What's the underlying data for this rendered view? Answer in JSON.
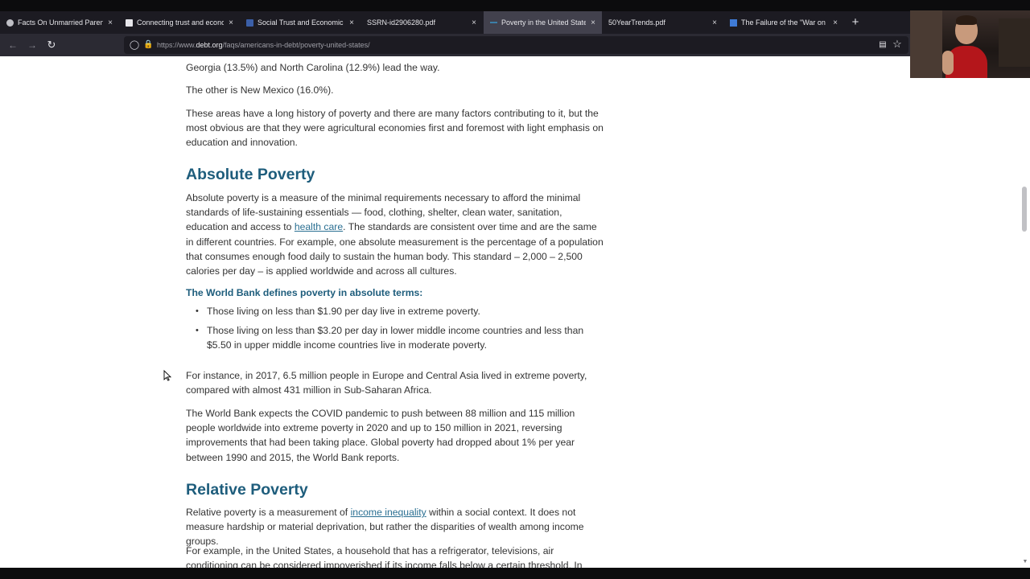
{
  "browser": {
    "tabs": [
      {
        "title": "Facts On Unmarried Parents in the",
        "favicon_color": "#bfbfc5"
      },
      {
        "title": "Connecting trust and economic",
        "favicon_color": "#e6e6ea"
      },
      {
        "title": "Social Trust and Economic Growth",
        "favicon_color": "#3b5fa8"
      },
      {
        "title": "SSRN-id2906280.pdf",
        "favicon_color": "#1c1b22"
      },
      {
        "title": "Poverty in the United States",
        "favicon_color": "#3c7fa8",
        "active": true
      },
      {
        "title": "50YearTrends.pdf",
        "favicon_color": "#1c1b22"
      },
      {
        "title": "The Failure of the \"War on Poverty\"",
        "favicon_color": "#3f7bd6"
      }
    ],
    "close_glyph": "×",
    "new_tab_glyph": "+",
    "url_prefix": "https://www.",
    "url_domain": "debt.org",
    "url_path": "/faqs/americans-in-debt/poverty-united-states/",
    "icons": {
      "back": "back-arrow-icon",
      "forward": "forward-arrow-icon",
      "reload": "reload-icon",
      "shield": "tracking-shield-icon",
      "lock": "lock-icon",
      "reader": "reader-view-icon",
      "bookmark": "bookmark-star-icon"
    }
  },
  "article": {
    "intro_line": "Georgia (13.5%) and North Carolina (12.9%) lead the way.",
    "other_line": "The other is New Mexico (16.0%).",
    "areas_paragraph": "These areas have a long history of poverty and there are many factors contributing to it, but the most obvious are that they were agricultural economies first and foremost with light emphasis on education and innovation.",
    "absolute_heading": "Absolute Poverty",
    "absolute_p_before_link": "Absolute poverty is a measure of the minimal requirements necessary to afford the minimal standards of life-sustaining essentials — food, clothing, shelter, clean water, sanitation, education and access to ",
    "absolute_link": "health care",
    "absolute_p_after_link": ". The standards are consistent over time and are the same in different countries. For example, one absolute measurement is the percentage of a population that consumes enough food daily to sustain the human body. This standard – 2,000 – 2,500 calories per day – is applied worldwide and across all cultures.",
    "world_bank_subheading": "The World Bank defines poverty in absolute terms:",
    "bullets": [
      "Those living on less than $1.90 per day live in extreme poverty.",
      "Those living on less than $3.20 per day in lower middle income countries and less than $5.50 in upper middle income countries live in moderate poverty."
    ],
    "instance_paragraph": "For instance, in 2017, 6.5 million people in Europe and Central Asia lived in extreme poverty, compared with almost 431 million in Sub-Saharan Africa.",
    "covid_paragraph": "The World Bank expects the COVID pandemic to push between 88 million and 115 million people worldwide into extreme poverty in 2020 and up to 150 million in 2021, reversing improvements that had been taking place. Global poverty had dropped about 1% per year between 1990 and 2015, the World Bank reports.",
    "relative_heading": "Relative Poverty",
    "relative_p_before_link": "Relative poverty is a measurement of ",
    "relative_link": "income inequality",
    "relative_p_after_link": " within a social context. It does not measure hardship or material deprivation, but rather the disparities of wealth among income groups.",
    "example_paragraph": "For example, in the United States, a household that has a refrigerator, televisions, air conditioning can be considered impoverished if its income falls below a certain threshold. In other countries, those"
  },
  "colors": {
    "heading": "#1e5d7c",
    "link": "#2a6f92",
    "body_text": "#333333",
    "chrome_dark": "#1c1b22",
    "chrome_active_tab": "#42414d"
  }
}
